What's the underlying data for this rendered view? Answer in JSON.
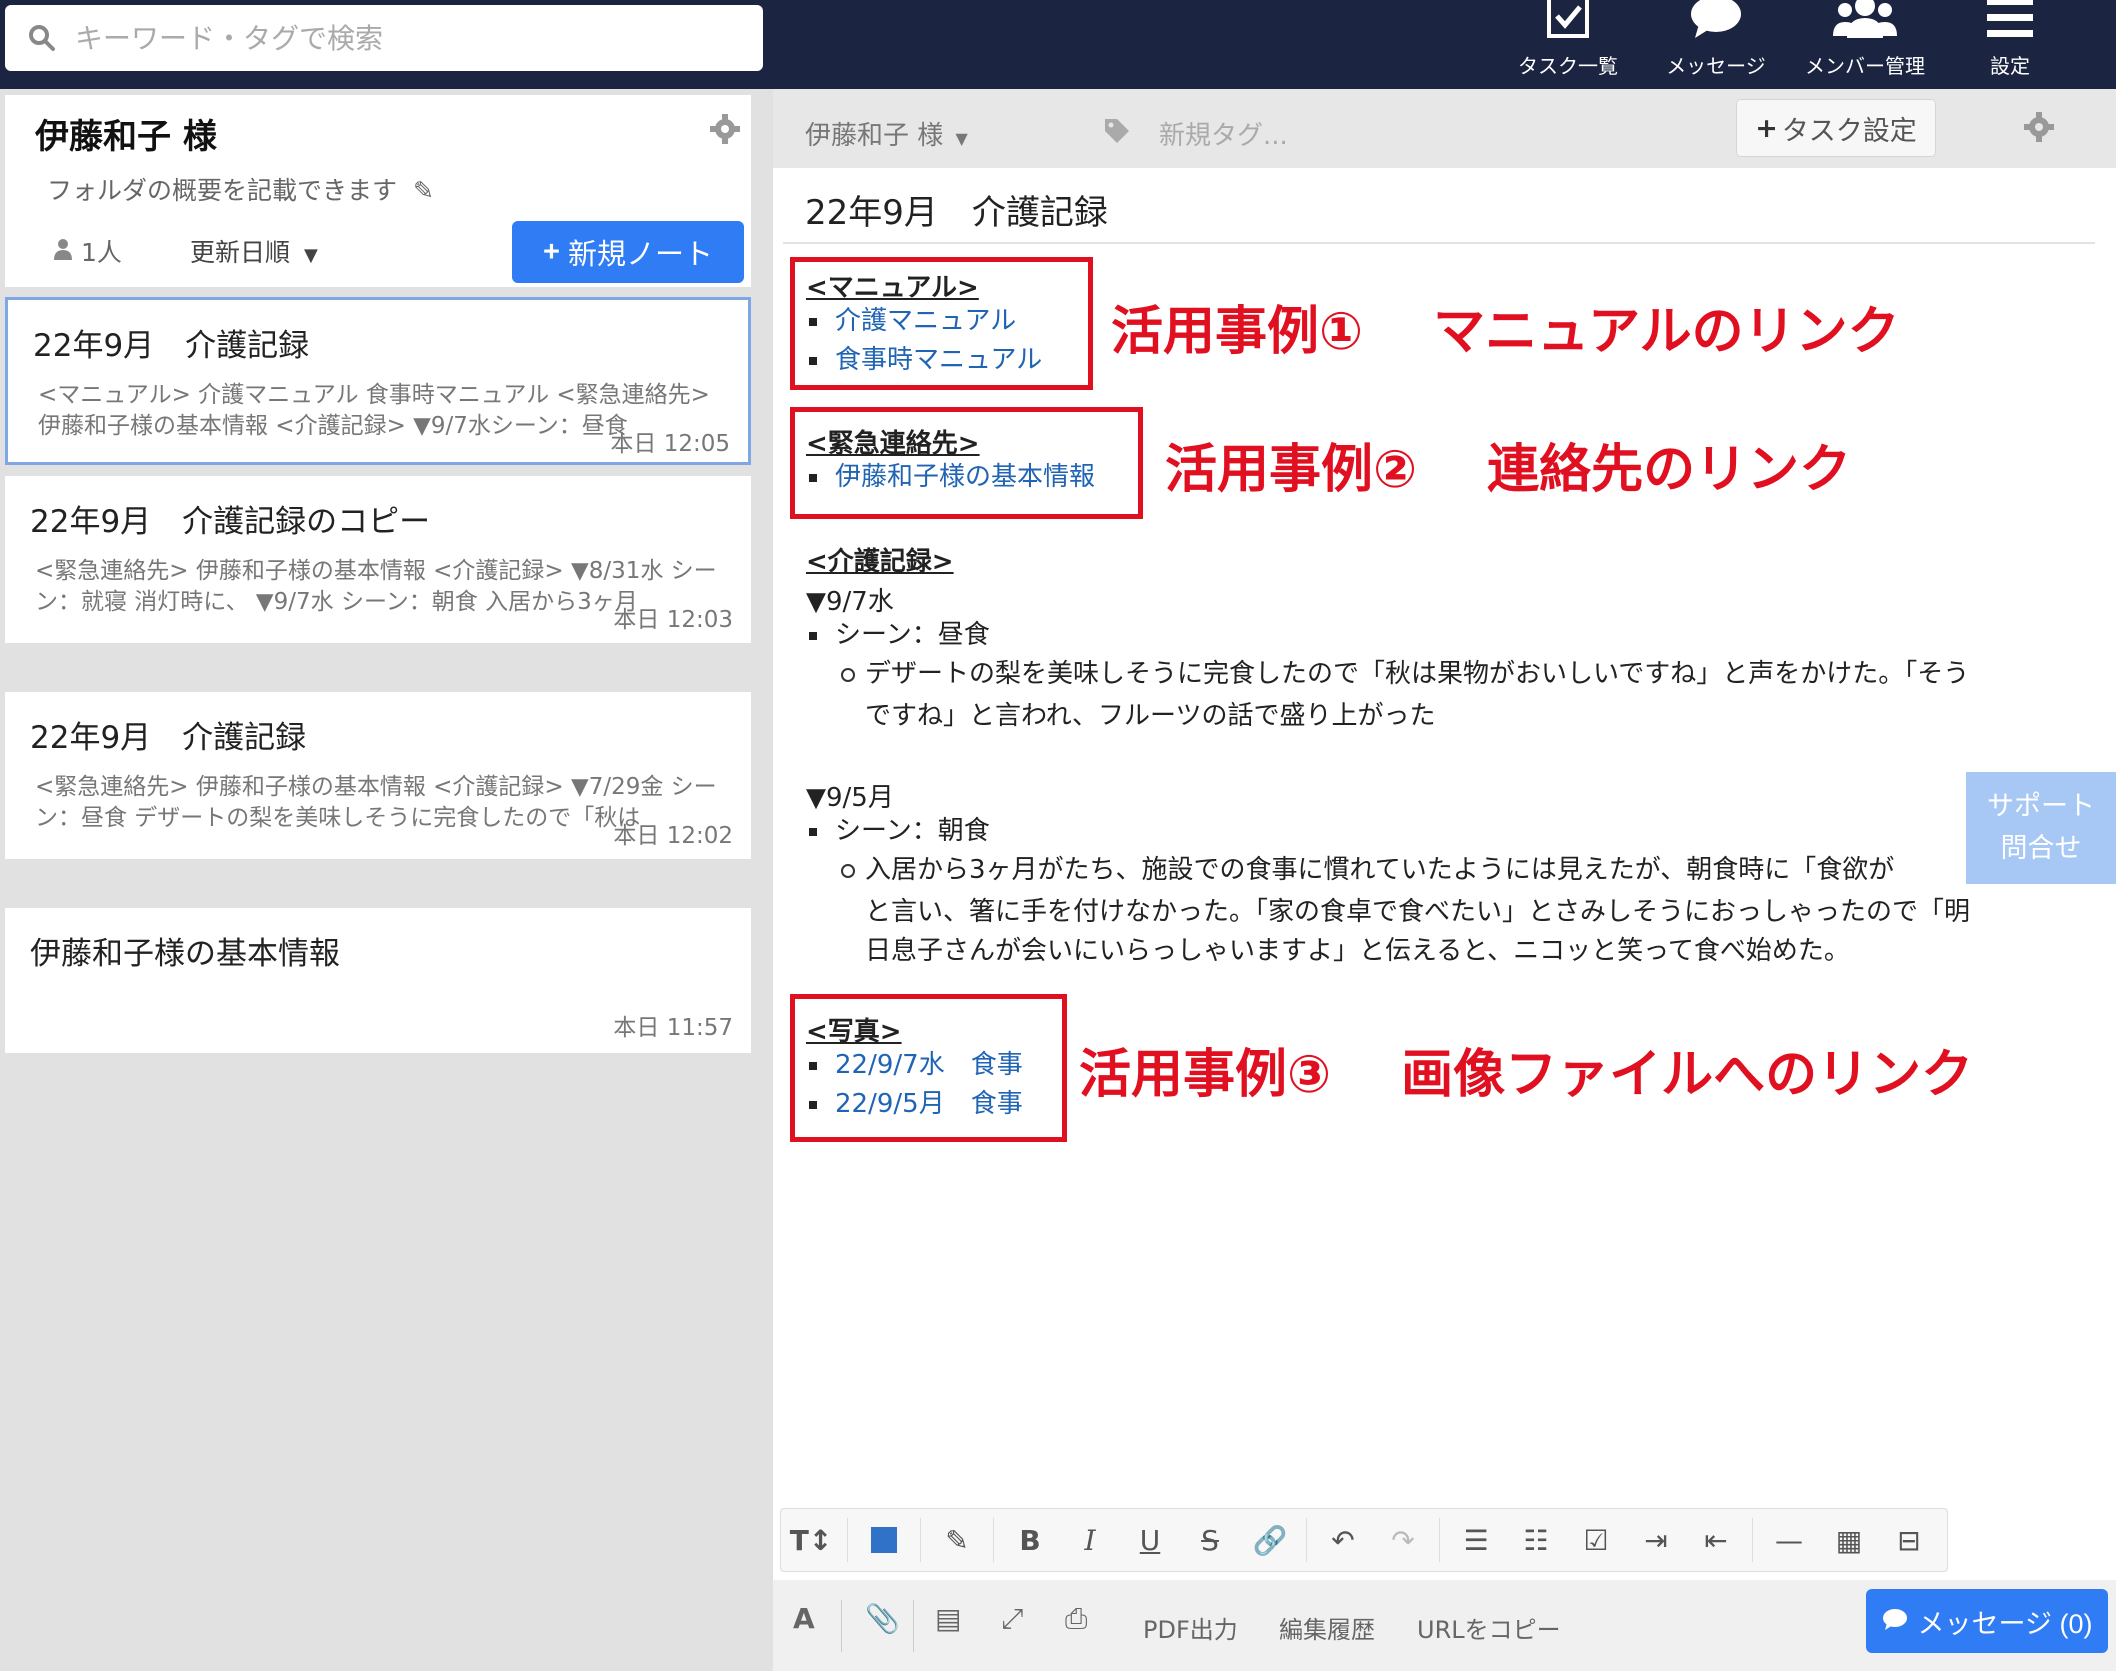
{
  "search": {
    "placeholder": "キーワード・タグで検索"
  },
  "nav": [
    {
      "label": "タスク一覧",
      "icon": "task-check-icon"
    },
    {
      "label": "メッセージ",
      "icon": "message-bubble-icon"
    },
    {
      "label": "メンバー管理",
      "icon": "members-icon"
    },
    {
      "label": "設定",
      "icon": "menu-icon"
    }
  ],
  "folder": {
    "title": "伊藤和子 様",
    "description": "フォルダの概要を記載できます",
    "members": "1人",
    "sort": "更新日順",
    "new_note": "新規ノート"
  },
  "notes": [
    {
      "title": "22年9月　介護記録",
      "snippet": "<マニュアル> 介護マニュアル 食事時マニュアル <緊急連絡先> 伊藤和子様の基本情報 <介護記録> ▼9/7水シーン：昼食",
      "time": "本日 12:05"
    },
    {
      "title": "22年9月　介護記録のコピー",
      "snippet": "<緊急連絡先> 伊藤和子様の基本情報 <介護記録> ▼8/31水 シーン：就寝 消灯時に、 ▼9/7水 シーン：朝食 入居から3ヶ月",
      "time": "本日 12:03"
    },
    {
      "title": "22年9月　介護記録",
      "snippet": "<緊急連絡先> 伊藤和子様の基本情報 <介護記録> ▼7/29金 シーン：昼食 デザートの梨を美味しそうに完食したので「秋は",
      "time": "本日 12:02"
    },
    {
      "title": "伊藤和子様の基本情報",
      "snippet": "",
      "time": "本日 11:57"
    }
  ],
  "header": {
    "owner": "伊藤和子 様",
    "tag_placeholder": "新規タグ...",
    "task_button": "タスク設定"
  },
  "doc": {
    "title": "22年9月　介護記録",
    "manual_heading": "<マニュアル>",
    "manual_links": [
      "介護マニュアル",
      "食事時マニュアル"
    ],
    "emergency_heading": "<緊急連絡先>",
    "emergency_links": [
      "伊藤和子様の基本情報"
    ],
    "care_heading": "<介護記録>",
    "entry1_date": "▼9/7水",
    "entry1_scene": "シーン：昼食",
    "entry1_text_1": "デザートの梨を美味しそうに完食したので「秋は果物がおいしいですね」と声をかけた。「そう",
    "entry1_text_2": "ですね」と言われ、フルーツの話で盛り上がった",
    "entry2_date": "▼9/5月",
    "entry2_scene": "シーン：朝食",
    "entry2_text_1": "入居から3ヶ月がたち、施設での食事に慣れていたようには見えたが、朝食時に「食欲が",
    "entry2_text_2": "と言い、箸に手を付けなかった。「家の食卓で食べたい」とさみしそうにおっしゃったので「明",
    "entry2_text_3": "日息子さんが会いにいらっしゃいますよ」と伝えると、ニコッと笑って食べ始めた。",
    "photo_heading": "<写真>",
    "photo_links": [
      "22/9/7水　食事",
      "22/9/5月　食事"
    ]
  },
  "annotations": [
    "活用事例①　 マニュアルのリンク",
    "活用事例②　 連絡先のリンク",
    "活用事例③　 画像ファイルへのリンク"
  ],
  "support": {
    "line1": "サポート",
    "line2": "問合せ"
  },
  "bottom": {
    "pdf": "PDF出力",
    "history": "編集履歴",
    "copy_url": "URLをコピー",
    "message": "メッセージ (0)"
  },
  "colors": {
    "topbar": "#1b2440",
    "accent": "#2f7cf5",
    "annotation": "#e01020",
    "link": "#2064b4"
  }
}
